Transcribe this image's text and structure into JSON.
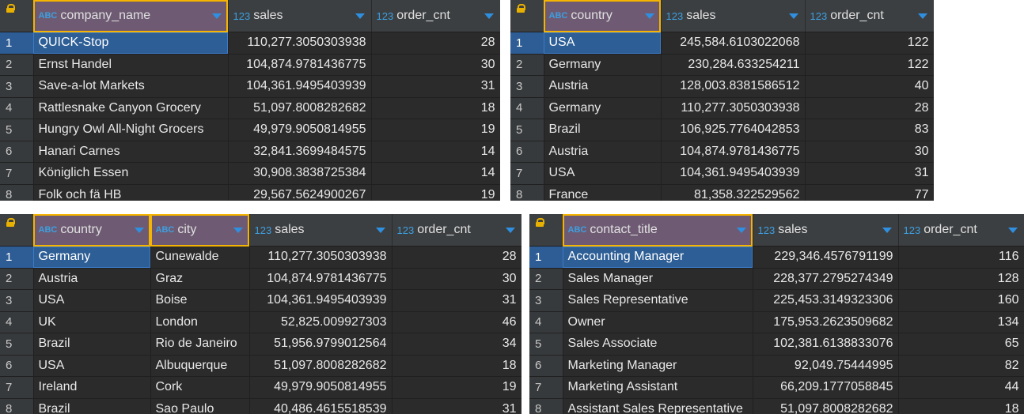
{
  "grids": [
    {
      "columns": [
        {
          "type_icon": "ABC",
          "name": "company_name"
        },
        {
          "type_icon": "123",
          "name": "sales"
        },
        {
          "type_icon": "123",
          "name": "order_cnt"
        }
      ],
      "rows": [
        {
          "num": "1",
          "cells": [
            "QUICK-Stop",
            "110,277.3050303938",
            "28"
          ]
        },
        {
          "num": "2",
          "cells": [
            "Ernst Handel",
            "104,874.9781436775",
            "30"
          ]
        },
        {
          "num": "3",
          "cells": [
            "Save-a-lot Markets",
            "104,361.9495403939",
            "31"
          ]
        },
        {
          "num": "4",
          "cells": [
            "Rattlesnake Canyon Grocery",
            "51,097.8008282682",
            "18"
          ]
        },
        {
          "num": "5",
          "cells": [
            "Hungry Owl All-Night Grocers",
            "49,979.9050814955",
            "19"
          ]
        },
        {
          "num": "6",
          "cells": [
            "Hanari Carnes",
            "32,841.3699484575",
            "14"
          ]
        },
        {
          "num": "7",
          "cells": [
            "Königlich Essen",
            "30,908.3838725384",
            "14"
          ]
        },
        {
          "num": "8",
          "cells": [
            "Folk och fä HB",
            "29,567.5624900267",
            "19"
          ]
        }
      ]
    },
    {
      "columns": [
        {
          "type_icon": "ABC",
          "name": "country"
        },
        {
          "type_icon": "123",
          "name": "sales"
        },
        {
          "type_icon": "123",
          "name": "order_cnt"
        }
      ],
      "rows": [
        {
          "num": "1",
          "cells": [
            "USA",
            "245,584.6103022068",
            "122"
          ]
        },
        {
          "num": "2",
          "cells": [
            "Germany",
            "230,284.633254211",
            "122"
          ]
        },
        {
          "num": "3",
          "cells": [
            "Austria",
            "128,003.8381586512",
            "40"
          ]
        },
        {
          "num": "4",
          "cells": [
            "Germany",
            "110,277.3050303938",
            "28"
          ]
        },
        {
          "num": "5",
          "cells": [
            "Brazil",
            "106,925.7764042853",
            "83"
          ]
        },
        {
          "num": "6",
          "cells": [
            "Austria",
            "104,874.9781436775",
            "30"
          ]
        },
        {
          "num": "7",
          "cells": [
            "USA",
            "104,361.9495403939",
            "31"
          ]
        },
        {
          "num": "8",
          "cells": [
            "France",
            "81,358.322529562",
            "77"
          ]
        }
      ]
    },
    {
      "columns": [
        {
          "type_icon": "ABC",
          "name": "country"
        },
        {
          "type_icon": "ABC",
          "name": "city"
        },
        {
          "type_icon": "123",
          "name": "sales"
        },
        {
          "type_icon": "123",
          "name": "order_cnt"
        }
      ],
      "rows": [
        {
          "num": "1",
          "cells": [
            "Germany",
            "Cunewalde",
            "110,277.3050303938",
            "28"
          ]
        },
        {
          "num": "2",
          "cells": [
            "Austria",
            "Graz",
            "104,874.9781436775",
            "30"
          ]
        },
        {
          "num": "3",
          "cells": [
            "USA",
            "Boise",
            "104,361.9495403939",
            "31"
          ]
        },
        {
          "num": "4",
          "cells": [
            "UK",
            "London",
            "52,825.009927303",
            "46"
          ]
        },
        {
          "num": "5",
          "cells": [
            "Brazil",
            "Rio de Janeiro",
            "51,956.9799012564",
            "34"
          ]
        },
        {
          "num": "6",
          "cells": [
            "USA",
            "Albuquerque",
            "51,097.8008282682",
            "18"
          ]
        },
        {
          "num": "7",
          "cells": [
            "Ireland",
            "Cork",
            "49,979.9050814955",
            "19"
          ]
        },
        {
          "num": "8",
          "cells": [
            "Brazil",
            "Sao Paulo",
            "40,486.4615518539",
            "31"
          ]
        }
      ]
    },
    {
      "columns": [
        {
          "type_icon": "ABC",
          "name": "contact_title"
        },
        {
          "type_icon": "123",
          "name": "sales"
        },
        {
          "type_icon": "123",
          "name": "order_cnt"
        }
      ],
      "rows": [
        {
          "num": "1",
          "cells": [
            "Accounting Manager",
            "229,346.4576791199",
            "116"
          ]
        },
        {
          "num": "2",
          "cells": [
            "Sales Manager",
            "228,377.2795274349",
            "128"
          ]
        },
        {
          "num": "3",
          "cells": [
            "Sales Representative",
            "225,453.3149323306",
            "160"
          ]
        },
        {
          "num": "4",
          "cells": [
            "Owner",
            "175,953.2623509682",
            "134"
          ]
        },
        {
          "num": "5",
          "cells": [
            "Sales Associate",
            "102,381.6138833076",
            "65"
          ]
        },
        {
          "num": "6",
          "cells": [
            "Marketing Manager",
            "92,049.75444995",
            "82"
          ]
        },
        {
          "num": "7",
          "cells": [
            "Marketing Assistant",
            "66,209.1777058845",
            "44"
          ]
        },
        {
          "num": "8",
          "cells": [
            "Assistant Sales Representative",
            "51,097.8008282682",
            "18"
          ]
        }
      ]
    }
  ],
  "colors": {
    "background": "#2b2b2b",
    "header": "#3c3f41",
    "highlight_border": "#f5b400",
    "selection": "#2d5e95",
    "type_icon": "#3d9fe0"
  }
}
